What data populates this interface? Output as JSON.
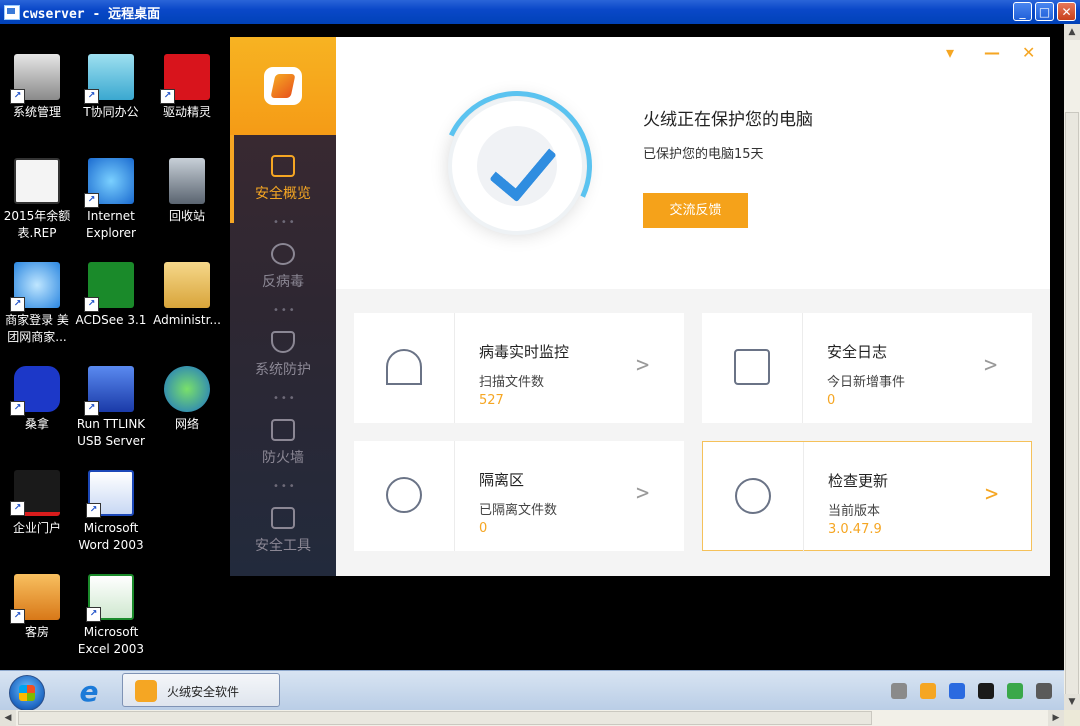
{
  "remote_window": {
    "title": "cwserver - 远程桌面"
  },
  "desktop_icons": [
    {
      "label": "系统管理",
      "icon": "system-admin-icon"
    },
    {
      "label": "T协同办公",
      "icon": "toa-icon"
    },
    {
      "label": "驱动精灵",
      "icon": "driver-genius-icon"
    },
    {
      "label": "2015年余额表.REP",
      "icon": "report-file-icon"
    },
    {
      "label": "Internet Explorer",
      "icon": "ie-icon"
    },
    {
      "label": "回收站",
      "icon": "recycle-bin-icon"
    },
    {
      "label": "商家登录 美团网商家...",
      "icon": "ie-shortcut-icon"
    },
    {
      "label": "ACDSee 3.1",
      "icon": "acdsee-icon"
    },
    {
      "label": "Administr...",
      "icon": "user-folder-icon"
    },
    {
      "label": "桑拿",
      "icon": "sauna-icon"
    },
    {
      "label": "Run TTLINK USB Server",
      "icon": "usb-server-icon"
    },
    {
      "label": "网络",
      "icon": "network-icon"
    },
    {
      "label": "企业门户",
      "icon": "t6-portal-icon"
    },
    {
      "label": "Microsoft Word 2003",
      "icon": "word-icon"
    },
    {
      "label": "客房",
      "icon": "home-icon"
    },
    {
      "label": "Microsoft Excel 2003",
      "icon": "excel-icon"
    }
  ],
  "taskbar": {
    "active_task_label": "火绒安全软件"
  },
  "huorong": {
    "nav": [
      {
        "label": "安全概览",
        "icon": "monitor-icon"
      },
      {
        "label": "反病毒",
        "icon": "gauge-icon"
      },
      {
        "label": "系统防护",
        "icon": "shield-icon"
      },
      {
        "label": "防火墙",
        "icon": "firewall-icon"
      },
      {
        "label": "安全工具",
        "icon": "toolbox-icon"
      }
    ],
    "status_title": "火绒正在保护您的电脑",
    "status_sub": "已保护您的电脑15天",
    "feedback_label": "交流反馈",
    "cards": [
      {
        "title": "病毒实时监控",
        "label": "扫描文件数",
        "value": "527",
        "icon": "umbrella-icon"
      },
      {
        "title": "安全日志",
        "label": "今日新增事件",
        "value": "0",
        "icon": "calendar-icon"
      },
      {
        "title": "隔离区",
        "label": "已隔离文件数",
        "value": "0",
        "icon": "biohazard-icon"
      },
      {
        "title": "检查更新",
        "label": "当前版本",
        "value": "3.0.47.9",
        "icon": "cloud-upload-icon"
      }
    ],
    "accent_color": "#f5a623"
  }
}
